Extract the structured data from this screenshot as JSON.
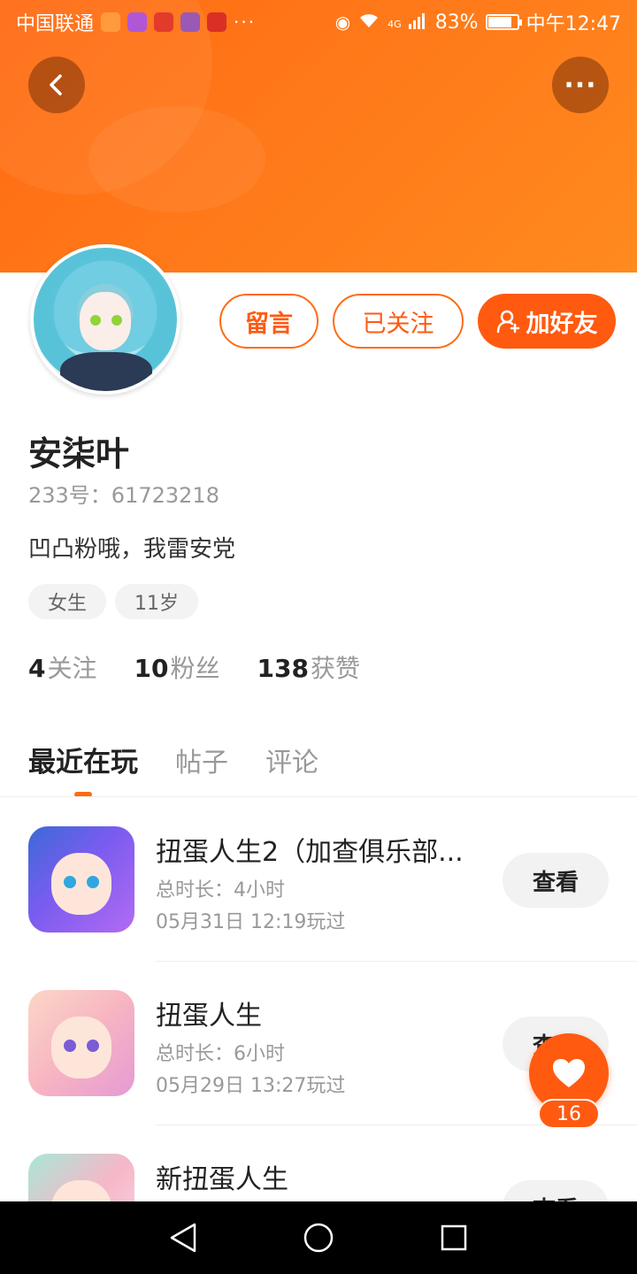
{
  "status_bar": {
    "carrier": "中国联通",
    "network": "4G",
    "battery": "83%",
    "battery_level": 0.83,
    "time": "中午12:47",
    "more": "···"
  },
  "header": {
    "back_icon": "chevron-left-icon",
    "more_icon": "more-horizontal-icon",
    "more_label": "···",
    "accent_color": "#ff6a12"
  },
  "profile": {
    "name": "安柒叶",
    "uid": "233号：61723218",
    "bio": "凹凸粉哦，我雷安党",
    "tags": [
      "女生",
      "11岁"
    ],
    "stats": [
      {
        "num": "4",
        "label": "关注"
      },
      {
        "num": "10",
        "label": "粉丝"
      },
      {
        "num": "138",
        "label": "获赞"
      }
    ]
  },
  "actions": {
    "message_label": "留言",
    "following_label": "已关注",
    "add_friend_label": "加好友"
  },
  "tabs": [
    {
      "label": "最近在玩",
      "active": true
    },
    {
      "label": "帖子",
      "active": false
    },
    {
      "label": "评论",
      "active": false
    }
  ],
  "games": [
    {
      "title": "扭蛋人生2（加查俱乐部...",
      "duration": "总时长：4小时",
      "played": "05月31日 12:19玩过",
      "button": "查看"
    },
    {
      "title": "扭蛋人生",
      "duration": "总时长：6小时",
      "played": "05月29日 13:27玩过",
      "button": "查看"
    },
    {
      "title": "新扭蛋人生",
      "duration": "",
      "played": "",
      "button": "查看"
    }
  ],
  "like_fab": {
    "icon": "heart-icon",
    "count": "16"
  }
}
